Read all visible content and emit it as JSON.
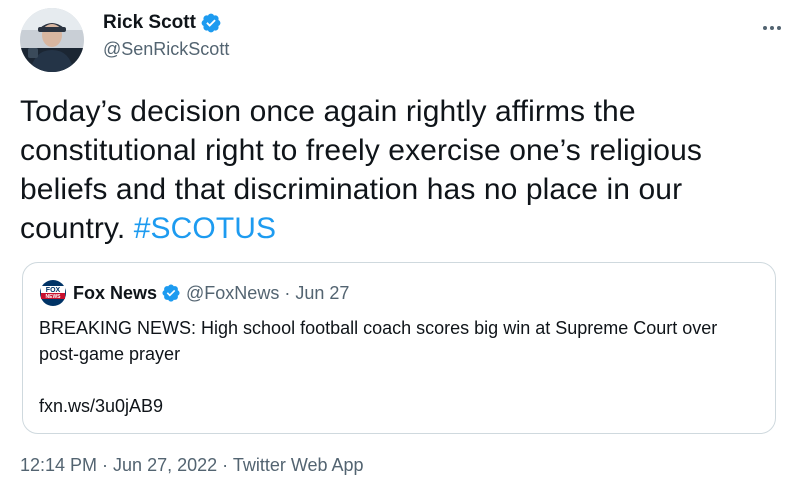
{
  "tweet": {
    "author": {
      "display_name": "Rick Scott",
      "handle": "@SenRickScott",
      "verified_icon": "verified-badge-icon"
    },
    "text": "Today’s decision once again rightly affirms the constitutional right to freely exercise one’s religious beliefs and that discrimination has no place in our country. ",
    "hashtag": "#SCOTUS",
    "timestamp": {
      "time": "12:14 PM",
      "separator1": " · ",
      "date": "Jun 27, 2022",
      "separator2": " · ",
      "source": "Twitter Web App"
    }
  },
  "quote": {
    "logo_text": "FOX NEWS",
    "display_name": "Fox News",
    "handle_date": "@FoxNews · Jun 27",
    "body": "BREAKING NEWS: High school football coach scores big win at Supreme Court over post-game prayer",
    "link": "fxn.ws/3u0jAB9"
  },
  "colors": {
    "accent": "#1d9bf0",
    "secondary_text": "#536471",
    "border": "#cfd9de"
  }
}
